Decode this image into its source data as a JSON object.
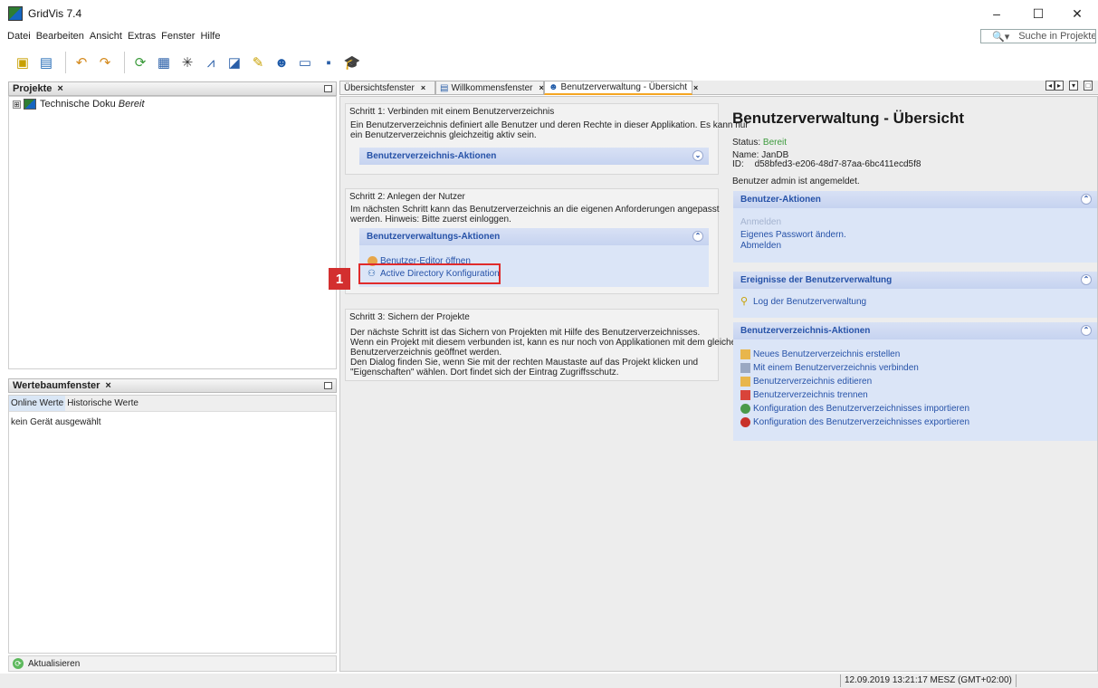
{
  "window": {
    "title": "GridVis 7.4",
    "controls": {
      "minimize": "–",
      "maximize": "☐",
      "close": "✕"
    }
  },
  "menu": {
    "items": [
      "Datei",
      "Bearbeiten",
      "Ansicht",
      "Extras",
      "Fenster",
      "Hilfe"
    ]
  },
  "search": {
    "placeholder": "Suche in Projekte (Ctrl+I)"
  },
  "projects_panel": {
    "title": "Projekte",
    "close": "×",
    "tree": {
      "toggle": "⊞",
      "name": "Technische Doku",
      "status": "Bereit"
    }
  },
  "werte_panel": {
    "title": "Wertebaumfenster",
    "close": "×",
    "tabs": [
      "Online Werte",
      "Historische Werte"
    ],
    "empty_text": "kein Gerät ausgewählt",
    "refresh": "Aktualisieren"
  },
  "tabs": [
    {
      "label": "Übersichtsfenster",
      "close": "×"
    },
    {
      "label": "Willkommensfenster",
      "close": "×"
    },
    {
      "label": "Benutzerverwaltung - Übersicht",
      "close": "×"
    }
  ],
  "step1": {
    "title": "Schritt 1: Verbinden mit einem Benutzerverzeichnis",
    "text": [
      "Ein Benutzerverzeichnis definiert alle Benutzer und deren Rechte in dieser Applikation. Es kann nur",
      "ein Benutzerverzeichnis gleichzeitig aktiv sein."
    ],
    "group": "Benutzerverzeichnis-Aktionen",
    "chev": "⌄"
  },
  "step2": {
    "title": "Schritt 2: Anlegen der Nutzer",
    "text": [
      "Im nächsten Schritt kann das Benutzerverzeichnis an die eigenen Anforderungen angepasst",
      "werden. Hinweis: Bitte zuerst einloggen."
    ],
    "group": "Benutzerverwaltungs-Aktionen",
    "chev": "⌃",
    "links": [
      "Benutzer-Editor öffnen",
      "Active Directory Konfiguration"
    ]
  },
  "step3": {
    "title": "Schritt 3: Sichern der Projekte",
    "text": [
      "Der nächste Schritt ist das Sichern von Projekten mit Hilfe des Benutzerverzeichnisses.",
      "Wenn ein Projekt mit diesem verbunden ist, kann es nur noch von Applikationen mit dem gleichen",
      "Benutzerverzeichnis geöffnet werden.",
      "Den Dialog finden Sie, wenn Sie mit der rechten Maustaste auf das Projekt klicken und",
      "\"Eigenschaften\" wählen. Dort findet sich der Eintrag Zugriffsschutz."
    ]
  },
  "badge": "1",
  "right": {
    "title": "Benutzerverwaltung - Übersicht",
    "status_label": "Status:",
    "status_value": "Bereit",
    "name_line": "Name: JanDB",
    "id_label": "ID:",
    "id_value": "d58bfed3-e206-48d7-87aa-6bc411ecd5f8",
    "logged_in": "Benutzer admin ist angemeldet.",
    "user_group": {
      "title": "Benutzer-Aktionen",
      "chev": "⌃",
      "items": [
        "Anmelden",
        "Eigenes Passwort ändern.",
        "Abmelden"
      ]
    },
    "events_group": {
      "title": "Ereignisse der Benutzerverwaltung",
      "chev": "⌃",
      "items": [
        "Log der Benutzerverwaltung"
      ]
    },
    "dir_group": {
      "title": "Benutzerverzeichnis-Aktionen",
      "chev": "⌃",
      "items": [
        "Neues Benutzerverzeichnis erstellen",
        "Mit einem Benutzerverzeichnis verbinden",
        "Benutzerverzeichnis editieren",
        "Benutzerverzeichnis trennen",
        "Konfiguration des Benutzerverzeichnisses importieren",
        "Konfiguration des Benutzerverzeichnisses exportieren"
      ]
    }
  },
  "statusbar": {
    "time": "12.09.2019 13:21:17 MESZ (GMT+02:00)"
  },
  "colors": {
    "accent": "#2652a8",
    "highlight": "#e02b2b",
    "badge": "#d32f2f",
    "status_ok": "#3c9a3c"
  }
}
